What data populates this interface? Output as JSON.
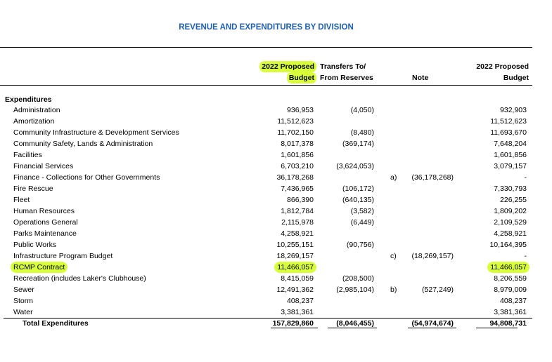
{
  "title": "REVENUE AND EXPENDITURES BY DIVISION",
  "headers": {
    "budget_line1": "2022 Proposed",
    "budget_line2": "Budget",
    "transfer_line1": "Transfers To/",
    "transfer_line2": "From Reserves",
    "note": "Note",
    "proposed_line1": "2022 Proposed",
    "proposed_line2": "Budget"
  },
  "section": "Expenditures",
  "highlight_color": "#d9ff3c",
  "title_color": "#1f5fb4",
  "rows": [
    {
      "name": "Administration",
      "budget": "936,953",
      "transfer": "(4,050)",
      "note_label": "",
      "note_value": "",
      "final": "932,903"
    },
    {
      "name": "Amortization",
      "budget": "11,512,623",
      "transfer": "",
      "note_label": "",
      "note_value": "",
      "final": "11,512,623"
    },
    {
      "name": "Community Infrastructure & Development Services",
      "budget": "11,702,150",
      "transfer": "(8,480)",
      "note_label": "",
      "note_value": "",
      "final": "11,693,670"
    },
    {
      "name": "Community Safety, Lands & Administration",
      "budget": "8,017,378",
      "transfer": "(369,174)",
      "note_label": "",
      "note_value": "",
      "final": "7,648,204"
    },
    {
      "name": "Facilities",
      "budget": "1,601,856",
      "transfer": "",
      "note_label": "",
      "note_value": "",
      "final": "1,601,856"
    },
    {
      "name": "Financial Services",
      "budget": "6,703,210",
      "transfer": "(3,624,053)",
      "note_label": "",
      "note_value": "",
      "final": "3,079,157"
    },
    {
      "name": "Finance - Collections for Other Governments",
      "budget": "36,178,268",
      "transfer": "",
      "note_label": "a)",
      "note_value": "(36,178,268)",
      "final": "-"
    },
    {
      "name": "Fire Rescue",
      "budget": "7,436,965",
      "transfer": "(106,172)",
      "note_label": "",
      "note_value": "",
      "final": "7,330,793"
    },
    {
      "name": "Fleet",
      "budget": "866,390",
      "transfer": "(640,135)",
      "note_label": "",
      "note_value": "",
      "final": "226,255"
    },
    {
      "name": "Human Resources",
      "budget": "1,812,784",
      "transfer": "(3,582)",
      "note_label": "",
      "note_value": "",
      "final": "1,809,202"
    },
    {
      "name": "Operations General",
      "budget": "2,115,978",
      "transfer": "(6,449)",
      "note_label": "",
      "note_value": "",
      "final": "2,109,529"
    },
    {
      "name": "Parks Maintenance",
      "budget": "4,258,921",
      "transfer": "",
      "note_label": "",
      "note_value": "",
      "final": "4,258,921"
    },
    {
      "name": "Public Works",
      "budget": "10,255,151",
      "transfer": "(90,756)",
      "note_label": "",
      "note_value": "",
      "final": "10,164,395"
    },
    {
      "name": "Infrastructure Program Budget",
      "budget": "18,269,157",
      "transfer": "",
      "note_label": "c)",
      "note_value": "(18,269,157)",
      "final": "-"
    },
    {
      "name": "RCMP Contract",
      "budget": "11,466,057",
      "transfer": "",
      "note_label": "",
      "note_value": "",
      "final": "11,466,057",
      "highlight": true
    },
    {
      "name": "Recreation (includes Laker's Clubhouse)",
      "budget": "8,415,059",
      "transfer": "(208,500)",
      "note_label": "",
      "note_value": "",
      "final": "8,206,559"
    },
    {
      "name": "Sewer",
      "budget": "12,491,362",
      "transfer": "(2,985,104)",
      "note_label": "b)",
      "note_value": "(527,249)",
      "final": "8,979,009"
    },
    {
      "name": "Storm",
      "budget": "408,237",
      "transfer": "",
      "note_label": "",
      "note_value": "",
      "final": "408,237"
    },
    {
      "name": "Water",
      "budget": "3,381,361",
      "transfer": "",
      "note_label": "",
      "note_value": "",
      "final": "3,381,361"
    }
  ],
  "total": {
    "name": "Total Expenditures",
    "budget": "157,829,860",
    "transfer": "(8,046,455)",
    "note_value": "(54,974,674)",
    "final": "94,808,731"
  }
}
